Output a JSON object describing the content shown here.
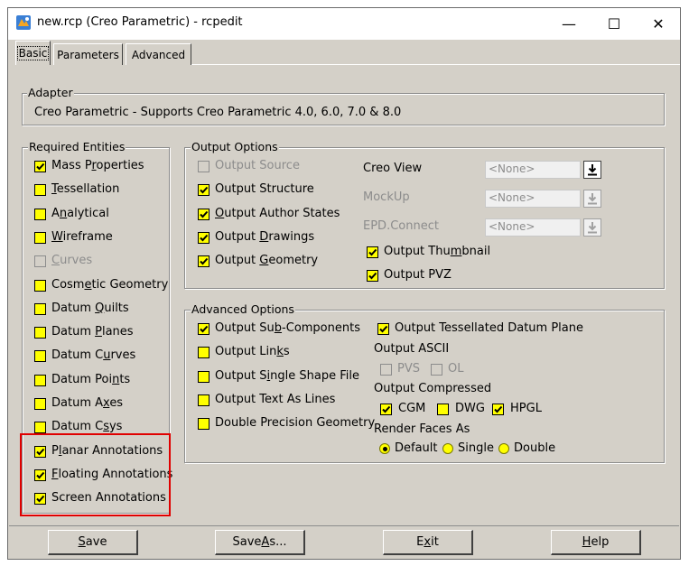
{
  "window": {
    "title": "new.rcp (Creo Parametric) - rcpedit",
    "controls": [
      "—",
      "☐",
      "✕"
    ]
  },
  "tabs": [
    {
      "label": "Basic",
      "active": true
    },
    {
      "label": "Parameters",
      "active": false
    },
    {
      "label": "Advanced",
      "active": false
    }
  ],
  "adapter": {
    "legend": "Adapter",
    "text": "Creo Parametric  -  Supports Creo Parametric 4.0, 6.0, 7.0 & 8.0"
  },
  "required_entities": {
    "legend": "Required Entities",
    "items": [
      {
        "pre": "Mass P",
        "u": "r",
        "post": "operties",
        "checked": true,
        "disabled": false
      },
      {
        "pre": "",
        "u": "T",
        "post": "essellation",
        "checked": false,
        "disabled": false
      },
      {
        "pre": "A",
        "u": "n",
        "post": "alytical",
        "checked": false,
        "disabled": false
      },
      {
        "pre": "",
        "u": "W",
        "post": "ireframe",
        "checked": false,
        "disabled": false
      },
      {
        "pre": "",
        "u": "C",
        "post": "urves",
        "checked": false,
        "disabled": true
      },
      {
        "pre": "Cosm",
        "u": "e",
        "post": "tic Geometry",
        "checked": false,
        "disabled": false
      },
      {
        "pre": "Datum ",
        "u": "Q",
        "post": "uilts",
        "checked": false,
        "disabled": false
      },
      {
        "pre": "Datum ",
        "u": "P",
        "post": "lanes",
        "checked": false,
        "disabled": false
      },
      {
        "pre": "Datum C",
        "u": "u",
        "post": "rves",
        "checked": false,
        "disabled": false
      },
      {
        "pre": "Datum Poi",
        "u": "n",
        "post": "ts",
        "checked": false,
        "disabled": false
      },
      {
        "pre": "Datum A",
        "u": "x",
        "post": "es",
        "checked": false,
        "disabled": false
      },
      {
        "pre": "Datum C",
        "u": "s",
        "post": "ys",
        "checked": false,
        "disabled": false
      },
      {
        "pre": "P",
        "u": "l",
        "post": "anar Annotations",
        "checked": true,
        "disabled": false
      },
      {
        "pre": "",
        "u": "F",
        "post": "loating Annotations",
        "checked": true,
        "disabled": false
      },
      {
        "pre": "Screen Annotations",
        "u": "",
        "post": "",
        "checked": true,
        "disabled": false
      }
    ]
  },
  "output_options": {
    "legend": "Output Options",
    "items": [
      {
        "pre": "Output Source",
        "u": "",
        "post": "",
        "checked": false,
        "disabled": true
      },
      {
        "pre": "Output Structure",
        "u": "",
        "post": "",
        "checked": true,
        "disabled": false
      },
      {
        "pre": "",
        "u": "O",
        "post": "utput Author States",
        "checked": true,
        "disabled": false
      },
      {
        "pre": "Output ",
        "u": "D",
        "post": "rawings",
        "checked": true,
        "disabled": false
      },
      {
        "pre": "Output ",
        "u": "G",
        "post": "eometry",
        "checked": true,
        "disabled": false
      }
    ],
    "viewers": [
      {
        "label": "Creo View",
        "value": "<None>",
        "disabled": false
      },
      {
        "label": "MockUp",
        "value": "<None>",
        "disabled": true
      },
      {
        "label": "EPD.Connect",
        "value": "<None>",
        "disabled": true
      }
    ],
    "download_icon": "download-arrow-icon",
    "extra": [
      {
        "pre": "Output Thu",
        "u": "m",
        "post": "bnail",
        "checked": true
      },
      {
        "pre": "Output PVZ",
        "u": "",
        "post": "",
        "checked": true
      }
    ]
  },
  "advanced_options": {
    "legend": "Advanced Options",
    "items": [
      {
        "pre": "Output Su",
        "u": "b",
        "post": "-Components",
        "checked": true
      },
      {
        "pre": "Output Lin",
        "u": "k",
        "post": "s",
        "checked": false
      },
      {
        "pre": "Output S",
        "u": "i",
        "post": "ngle Shape File",
        "checked": false
      },
      {
        "pre": "Output Text As Lines",
        "u": "",
        "post": "",
        "checked": false
      },
      {
        "pre": "Double Precision Geometry",
        "u": "",
        "post": "",
        "checked": false
      }
    ],
    "tessellated_datum_plane": {
      "label": "Output Tessellated Datum Plane",
      "checked": true
    },
    "output_ascii": {
      "label": "Output ASCII",
      "options": [
        {
          "label": "PVS",
          "checked": false,
          "disabled": true
        },
        {
          "label": "OL",
          "checked": false,
          "disabled": true
        }
      ]
    },
    "output_compressed": {
      "label": "Output Compressed",
      "options": [
        {
          "label": "CGM",
          "checked": true
        },
        {
          "label": "DWG",
          "checked": false
        },
        {
          "label": "HPGL",
          "checked": true
        }
      ]
    },
    "render_faces": {
      "label": "Render Faces As",
      "options": [
        {
          "label": "Default",
          "selected": true
        },
        {
          "label": "Single",
          "selected": false
        },
        {
          "label": "Double",
          "selected": false
        }
      ]
    }
  },
  "buttons": [
    {
      "pre": "",
      "u": "S",
      "post": "ave"
    },
    {
      "pre": "Save ",
      "u": "A",
      "post": "s..."
    },
    {
      "pre": "E",
      "u": "x",
      "post": "it"
    },
    {
      "pre": "",
      "u": "H",
      "post": "elp"
    }
  ],
  "colors": {
    "dialog_bg": "#d4d0c8",
    "checkbox_fill": "#ffff00",
    "highlight_border": "#e00000"
  }
}
